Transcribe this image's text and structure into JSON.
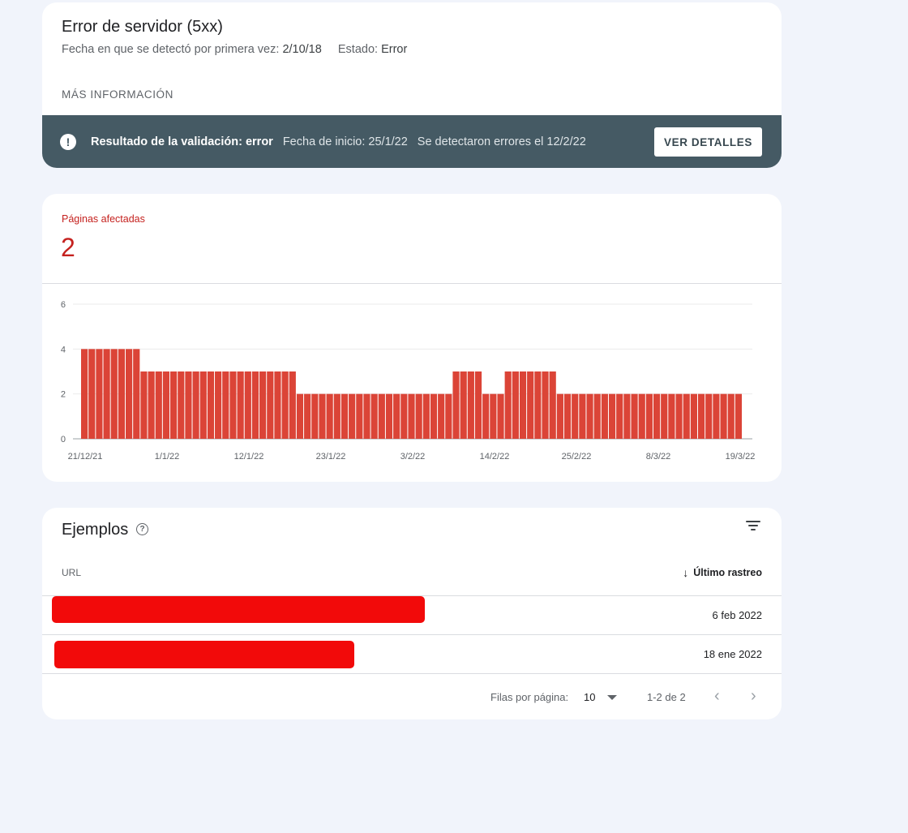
{
  "issue": {
    "title": "Error de servidor (5xx)",
    "first_detected_label": "Fecha en que se detectó por primera vez:",
    "first_detected_value": "2/10/18",
    "status_label": "Estado:",
    "status_value": "Error",
    "more_info": "MÁS INFORMACIÓN"
  },
  "validation": {
    "icon": "alert-circle-icon",
    "title": "Resultado de la validación: error",
    "start_date": "Fecha de inicio: 25/1/22",
    "errors_detected": "Se detectaron errores el 12/2/22",
    "details_button": "VER DETALLES",
    "bar_color": "#455a64"
  },
  "metric": {
    "label": "Páginas afectadas",
    "value": "2",
    "color": "#c5221f"
  },
  "chart_data": {
    "type": "bar",
    "bar_color": "#db4437",
    "ylim": [
      0,
      6
    ],
    "yticks": [
      0,
      2,
      4,
      6
    ],
    "xticks": [
      "21/12/21",
      "1/1/22",
      "12/1/22",
      "23/1/22",
      "3/2/22",
      "14/2/22",
      "25/2/22",
      "8/3/22",
      "19/3/22"
    ],
    "start_date": "21/12/21",
    "end_date": "19/3/22",
    "values": [
      4,
      4,
      4,
      4,
      4,
      4,
      4,
      4,
      3,
      3,
      3,
      3,
      3,
      3,
      3,
      3,
      3,
      3,
      3,
      3,
      3,
      3,
      3,
      3,
      3,
      3,
      3,
      3,
      3,
      2,
      2,
      2,
      2,
      2,
      2,
      2,
      2,
      2,
      2,
      2,
      2,
      2,
      2,
      2,
      2,
      2,
      2,
      2,
      2,
      2,
      3,
      3,
      3,
      3,
      2,
      2,
      2,
      3,
      3,
      3,
      3,
      3,
      3,
      3,
      2,
      2,
      2,
      2,
      2,
      2,
      2,
      2,
      2,
      2,
      2,
      2,
      2,
      2,
      2,
      2,
      2,
      2,
      2,
      2,
      2,
      2,
      2,
      2,
      2
    ]
  },
  "examples": {
    "title": "Ejemplos",
    "help_icon": "help-circle-icon",
    "filter_icon": "filter-icon",
    "col_url": "URL",
    "col_last_crawl": "Último rastreo",
    "sort_icon": "arrow-down-icon",
    "rows": [
      {
        "url": "[redacted]",
        "date": "6 feb 2022"
      },
      {
        "url": "[redacted]",
        "date": "18 ene 2022"
      }
    ],
    "rows_per_page_label": "Filas por página:",
    "rows_per_page_value": "10",
    "range": "1-2 de 2"
  }
}
